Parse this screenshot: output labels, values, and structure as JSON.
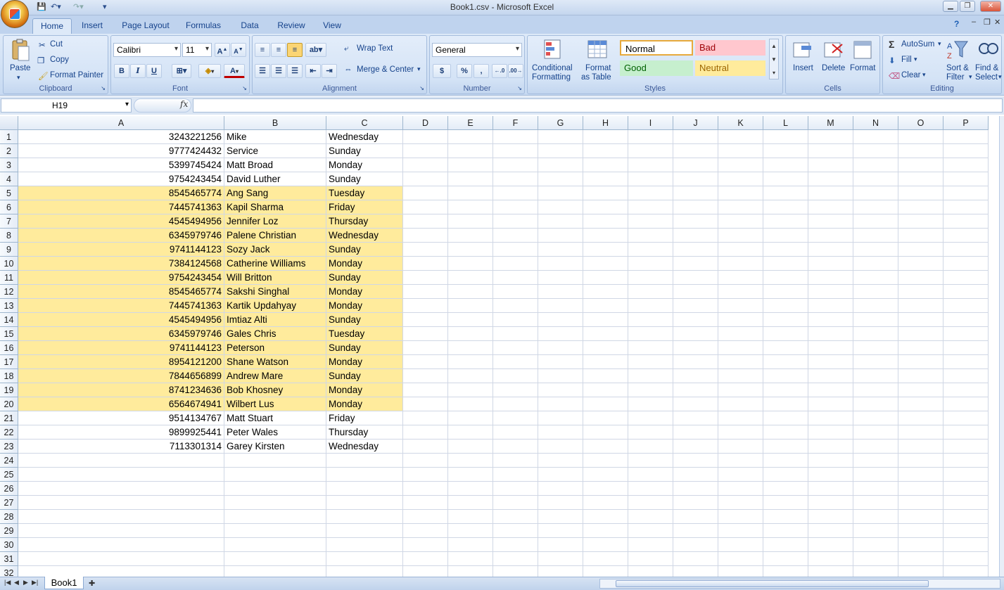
{
  "window": {
    "title": "Book1.csv - Microsoft Excel"
  },
  "ribbon_tabs": [
    "Home",
    "Insert",
    "Page Layout",
    "Formulas",
    "Data",
    "Review",
    "View"
  ],
  "clipboard": {
    "paste": "Paste",
    "cut": "Cut",
    "copy": "Copy",
    "format_painter": "Format Painter",
    "group": "Clipboard"
  },
  "font": {
    "name": "Calibri",
    "size": "11",
    "bold": "B",
    "italic": "I",
    "underline": "U",
    "group": "Font"
  },
  "alignment": {
    "wrap_text": "Wrap Text",
    "merge_center": "Merge & Center",
    "group": "Alignment"
  },
  "number": {
    "format": "General",
    "currency": "$",
    "percent": "%",
    "comma": ",",
    "group": "Number"
  },
  "styles": {
    "conditional": "Conditional",
    "formatting": "Formatting",
    "format_as": "Format",
    "as_table": "as Table",
    "normal": "Normal",
    "bad": "Bad",
    "good": "Good",
    "neutral": "Neutral",
    "group": "Styles"
  },
  "cells": {
    "insert": "Insert",
    "delete": "Delete",
    "format": "Format",
    "group": "Cells"
  },
  "editing": {
    "autosum": "AutoSum",
    "fill": "Fill",
    "clear": "Clear",
    "sort": "Sort &",
    "filter": "Filter",
    "find": "Find &",
    "select": "Select",
    "group": "Editing"
  },
  "formula_bar": {
    "name_box": "H19",
    "fx": "fx",
    "formula": ""
  },
  "columns": [
    "A",
    "B",
    "C",
    "D",
    "E",
    "F",
    "G",
    "H",
    "I",
    "J",
    "K",
    "L",
    "M",
    "N",
    "O",
    "P"
  ],
  "rows": [
    "1",
    "2",
    "3",
    "4",
    "5",
    "6",
    "7",
    "8",
    "9",
    "10",
    "11",
    "12",
    "13",
    "14",
    "15",
    "16",
    "17",
    "18",
    "19",
    "20",
    "21",
    "22",
    "23",
    "24",
    "25",
    "26",
    "27",
    "28",
    "29",
    "30",
    "31",
    "32"
  ],
  "data": [
    [
      "3243221256",
      "Mike",
      "Wednesday"
    ],
    [
      "9777424432",
      "Service",
      "Sunday"
    ],
    [
      "5399745424",
      "Matt Broad",
      "Monday"
    ],
    [
      "9754243454",
      "David Luther",
      "Sunday"
    ],
    [
      "8545465774",
      "Ang Sang",
      "Tuesday"
    ],
    [
      "7445741363",
      "Kapil Sharma",
      "Friday"
    ],
    [
      "4545494956",
      "Jennifer Loz",
      "Thursday"
    ],
    [
      "6345979746",
      "Palene Christian",
      "Wednesday"
    ],
    [
      "9741144123",
      "Sozy Jack",
      "Sunday"
    ],
    [
      "7384124568",
      "Catherine Williams",
      "Monday"
    ],
    [
      "9754243454",
      "Will Britton",
      "Sunday"
    ],
    [
      "8545465774",
      "Sakshi Singhal",
      "Monday"
    ],
    [
      "7445741363",
      "Kartik Updahyay",
      "Monday"
    ],
    [
      "4545494956",
      "Imtiaz Alti",
      "Sunday"
    ],
    [
      "6345979746",
      "Gales Chris",
      "Tuesday"
    ],
    [
      "9741144123",
      "Peterson",
      "Sunday"
    ],
    [
      "8954121200",
      "Shane Watson",
      "Monday"
    ],
    [
      "7844656899",
      "Andrew Mare",
      "Sunday"
    ],
    [
      "8741234636",
      "Bob Khosney",
      "Monday"
    ],
    [
      "6564674941",
      "Wilbert Lus",
      "Monday"
    ],
    [
      "9514134767",
      "Matt Stuart",
      "Friday"
    ],
    [
      "9899925441",
      "Peter Wales",
      "Thursday"
    ],
    [
      "7113301314",
      "Garey Kirsten",
      "Wednesday"
    ]
  ],
  "highlighted_rows": [
    "5",
    "6",
    "7",
    "8",
    "9",
    "10",
    "11",
    "12",
    "13",
    "14",
    "15",
    "16",
    "17",
    "18",
    "19",
    "20"
  ],
  "highlight_color": "#ffeb9c",
  "sheet_tabs": [
    "Book1"
  ]
}
